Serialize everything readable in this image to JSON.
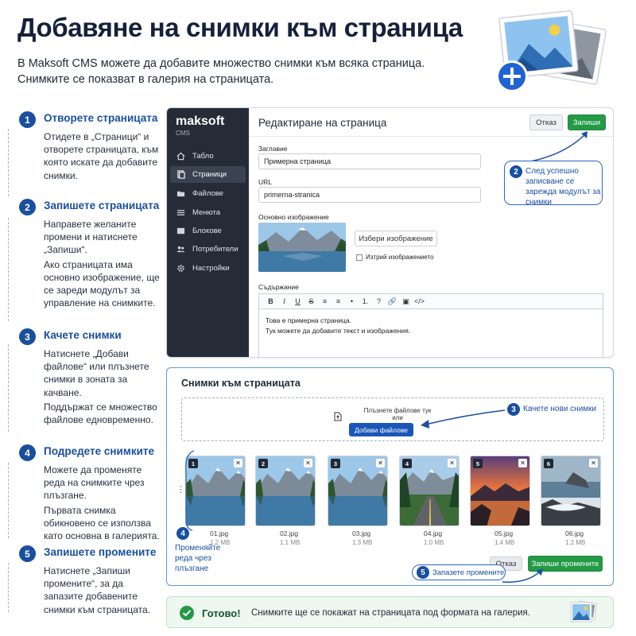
{
  "header": {
    "title": "Добавяне на снимки към страница",
    "subtitle_line1": "В Maksoft CMS можете да добавите множество снимки към всяка страница.",
    "subtitle_line2": "Снимките се показват в галерия на страницата."
  },
  "steps": [
    {
      "num": "1",
      "title": "Отворете страницата",
      "body": [
        "Отидете в „Страници“ и отворете страницата, към която искате да добавите снимки."
      ]
    },
    {
      "num": "2",
      "title": "Запишете страницата",
      "body": [
        "Направете желаните промени и натиснете „Запиши“.",
        "Ако страницата има основно изображение, ще се зареди модулът за управление на снимките."
      ]
    },
    {
      "num": "3",
      "title": "Качете снимки",
      "body": [
        "Натиснете „Добави файлове“ или плъзнете снимки в зоната за качване.",
        "Поддържат се множество файлове едновременно."
      ]
    },
    {
      "num": "4",
      "title": "Подредете снимките",
      "body": [
        "Можете да променяте реда на снимките чрез плъзгане.",
        "Първата снимка обикновено се използва като основна в галерията."
      ]
    },
    {
      "num": "5",
      "title": "Запишете промените",
      "body": [
        "Натиснете „Запиши промените“, за да запазите добавените снимки към страницата."
      ]
    }
  ],
  "cms": {
    "logo": "maksoft",
    "logo_sub": "CMS",
    "nav": [
      {
        "label": "Табло",
        "icon": "home-icon"
      },
      {
        "label": "Страници",
        "icon": "pages-icon"
      },
      {
        "label": "Файлове",
        "icon": "folder-icon"
      },
      {
        "label": "Менюта",
        "icon": "menu-icon"
      },
      {
        "label": "Блокове",
        "icon": "blocks-icon"
      },
      {
        "label": "Потребители",
        "icon": "users-icon"
      },
      {
        "label": "Настройки",
        "icon": "gear-icon"
      }
    ],
    "page_heading": "Редактиране на страница",
    "cancel_label": "Отказ",
    "save_label": "Запиши",
    "title_label": "Заглавие",
    "title_value": "Примерна страница",
    "url_label": "URL",
    "url_value": "primerna-stranica",
    "main_image_label": "Основно изображение",
    "choose_image_label": "Избери изображение",
    "delete_image_label": "Изтрий изображението",
    "content_label": "Съдържание",
    "toolbar": [
      "B",
      "I",
      "U",
      "S",
      "≡",
      "≡",
      "•",
      "1.",
      "?",
      "🔗",
      "▣",
      "</>"
    ],
    "content_line1": "Това е примерна страница.",
    "content_line2": "Тук можете да добавите текст и изображения."
  },
  "callouts": {
    "c2_num": "2",
    "c2_text": "След успешно записване се зарежда модулът за снимки",
    "c3_num": "3",
    "c3_text": "Качете нови снимки",
    "c4_num": "4",
    "c4_text": "Променяйте реда чрез плъзгане",
    "c5_num": "5",
    "c5_text": "Запазете промените"
  },
  "gallery": {
    "heading": "Снимки към страницата",
    "drop_line1": "Плъзнете файлове тук",
    "drop_line2": "или",
    "add_files_label": "Добави файлове",
    "cancel_label": "Отказ",
    "save_changes_label": "Запиши промените",
    "files": [
      {
        "num": "1",
        "name": "01.jpg",
        "size": "1.2 MB",
        "scene": "lake"
      },
      {
        "num": "2",
        "name": "02.jpg",
        "size": "1.1 MB",
        "scene": "lake"
      },
      {
        "num": "3",
        "name": "03.jpg",
        "size": "1.3 MB",
        "scene": "lake"
      },
      {
        "num": "4",
        "name": "04.jpg",
        "size": "1.0 MB",
        "scene": "road"
      },
      {
        "num": "5",
        "name": "05.jpg",
        "size": "1.4 MB",
        "scene": "sunset"
      },
      {
        "num": "6",
        "name": "06.jpg",
        "size": "1.2 MB",
        "scene": "coast"
      }
    ]
  },
  "footer": {
    "done_label": "Готово!",
    "done_text": "Снимките ще се покажат на страницата под формата на галерия."
  },
  "colors": {
    "primary": "#1a4fa0",
    "green": "#239a45",
    "sidebar": "#252c38"
  }
}
